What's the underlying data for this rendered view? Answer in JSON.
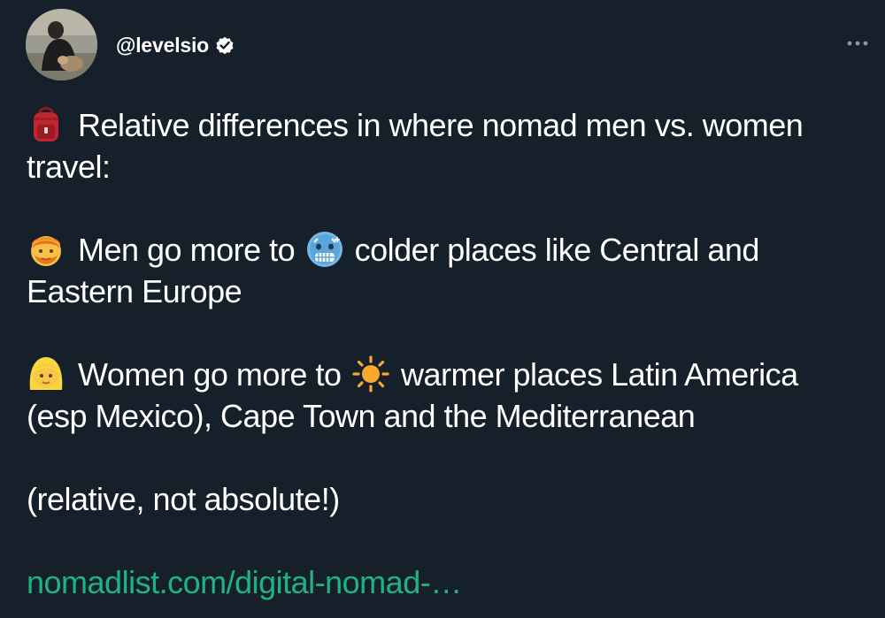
{
  "author": {
    "handle": "@levelsio",
    "verified": true,
    "avatar_icon": "avatar-photo-person-with-dog"
  },
  "menu": {
    "more_icon": "more-options-icon"
  },
  "tweet": {
    "line1_emoji": "backpack-emoji",
    "line1_text": "Relative differences in where nomad men vs. women",
    "line2_text": "travel:",
    "men_emoji": "man-emoji",
    "men_text_a": "Men go more to",
    "cold_emoji": "cold-face-emoji",
    "men_text_b": "colder places like Central and",
    "men_text_c": "Eastern Europe",
    "women_emoji": "woman-emoji",
    "women_text_a": "Women go more to",
    "sun_emoji": "sun-emoji",
    "women_text_b": "warmer places Latin America",
    "women_text_c": "(esp Mexico), Cape Town and the Mediterranean",
    "note": "(relative, not absolute!)",
    "link": "nomadlist.com/digital-nomad-…"
  },
  "colors": {
    "background": "#15202b",
    "text": "#ffffff",
    "link": "#1fb283",
    "verified": "#ffffff"
  }
}
